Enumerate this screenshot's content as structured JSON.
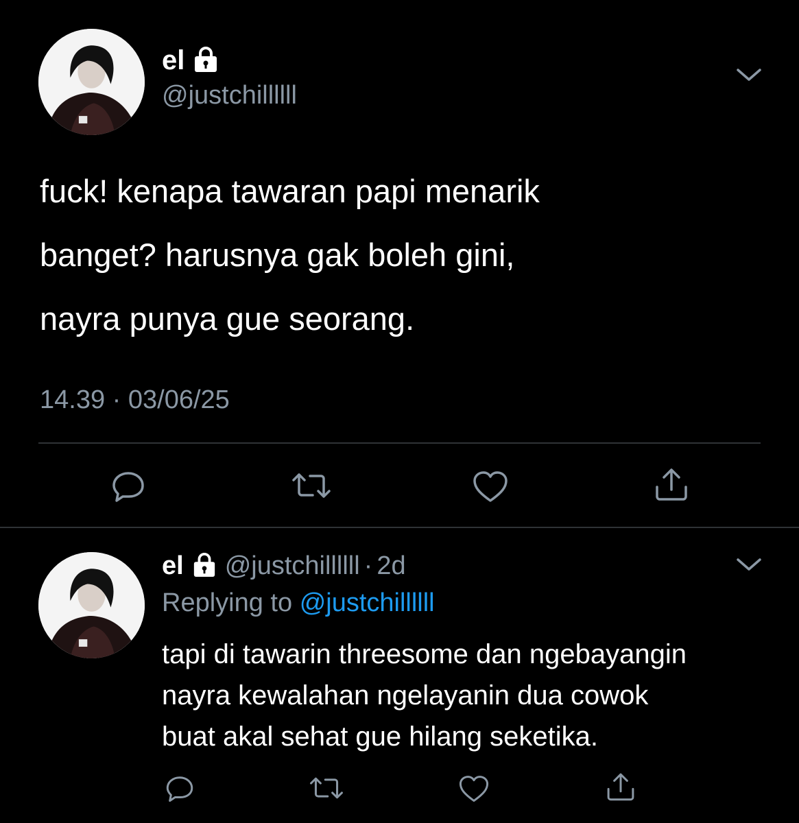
{
  "main_tweet": {
    "display_name": "el",
    "handle": "@justchillllll",
    "lines": [
      "fuck! kenapa tawaran papi menarik",
      "banget? harusnya gak boleh gini,",
      "nayra punya gue seorang."
    ],
    "timestamp": "14.39 · 03/06/25",
    "actions": {
      "reply": "reply-icon",
      "retweet": "retweet-icon",
      "like": "heart-icon",
      "share": "share-icon"
    }
  },
  "reply_tweet": {
    "display_name": "el",
    "handle": "@justchillllll",
    "separator": "·",
    "age": "2d",
    "replying_prefix": "Replying to",
    "replying_handle": "@justchillllll",
    "lines": [
      "tapi di tawarin threesome dan ngebayangin",
      "nayra kewalahan ngelayanin dua cowok",
      "buat akal sehat gue hilang seketika."
    ]
  },
  "colors": {
    "background": "#000000",
    "text": "#ffffff",
    "muted": "#8b98a5",
    "link": "#1d9bf0",
    "divider": "#2f3336"
  }
}
